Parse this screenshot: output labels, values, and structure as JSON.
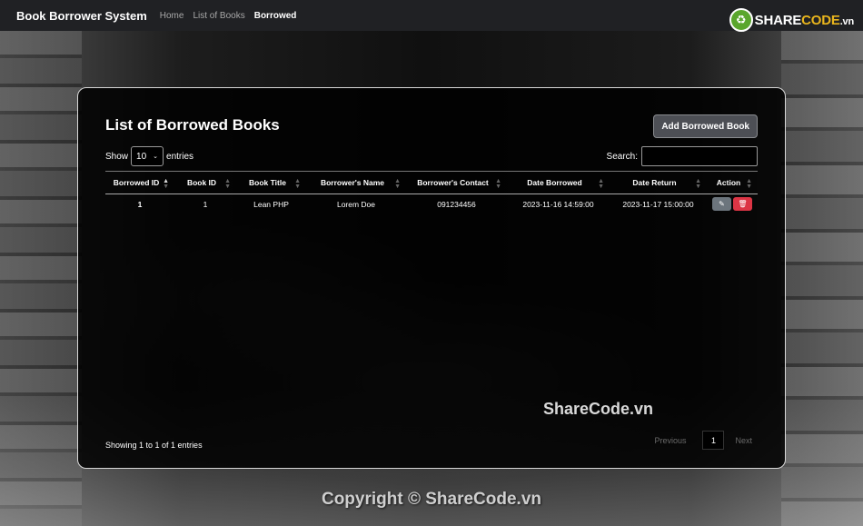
{
  "navbar": {
    "brand": "Book Borrower System",
    "links": [
      "Home",
      "List of Books",
      "Borrowed"
    ],
    "active_link": "Borrowed"
  },
  "logo": {
    "share": "SHARE",
    "code": "CODE",
    "tld": ".vn"
  },
  "card": {
    "title": "List of Borrowed Books",
    "add_button": "Add Borrowed Book"
  },
  "controls": {
    "show_label": "Show",
    "entries_value": "10",
    "entries_label": "entries",
    "search_label": "Search:"
  },
  "table": {
    "columns": [
      "Borrowed ID",
      "Book ID",
      "Book Title",
      "Borrower's Name",
      "Borrower's Contact",
      "Date Borrowed",
      "Date Return",
      "Action"
    ],
    "rows": [
      [
        "1",
        "1",
        "Lean PHP",
        "Lorem Doe",
        "091234456",
        "2023-11-16 14:59:00",
        "2023-11-17 15:00:00"
      ]
    ]
  },
  "footer": {
    "info": "Showing 1 to 1 of 1 entries",
    "prev": "Previous",
    "current_page": "1",
    "next": "Next"
  },
  "watermark": "ShareCode.vn",
  "copyright": "Copyright © ShareCode.vn",
  "icons": {
    "edit": "pencil-icon",
    "delete": "trash-icon",
    "logo": "recycle-icon"
  },
  "colors": {
    "edit_button": "#6c757d",
    "delete_button": "#dc3545",
    "logo_green": "#5aa62d",
    "logo_gold": "#e9b51d"
  }
}
